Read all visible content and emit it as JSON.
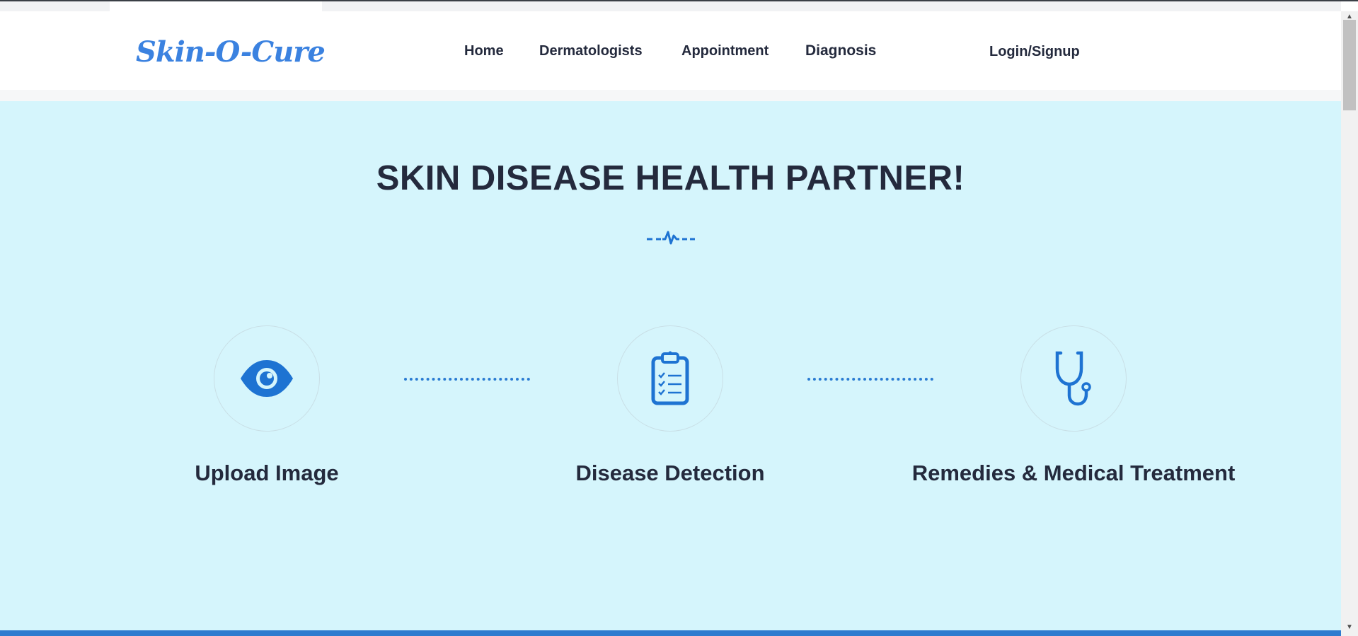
{
  "header": {
    "logo": "Skin-O-Cure",
    "nav": {
      "home": "Home",
      "dermatologists": "Dermatologists",
      "appointment": "Appointment",
      "diagnosis": "Diagnosis",
      "login": "Login/Signup"
    }
  },
  "hero": {
    "title": "SKIN DISEASE HEALTH PARTNER!",
    "divider_icon": "heartbeat-line-icon",
    "steps": [
      {
        "icon": "eye-icon",
        "label": "Upload Image"
      },
      {
        "icon": "clipboard-checklist-icon",
        "label": "Disease Detection"
      },
      {
        "icon": "stethoscope-icon",
        "label": "Remedies & Medical Treatment"
      }
    ]
  },
  "colors": {
    "brand_blue": "#3b82e0",
    "icon_blue": "#1e73d2",
    "hero_background": "#d5f5fc",
    "text_dark": "#242a3d",
    "bottom_bar": "#2e7bcf"
  }
}
